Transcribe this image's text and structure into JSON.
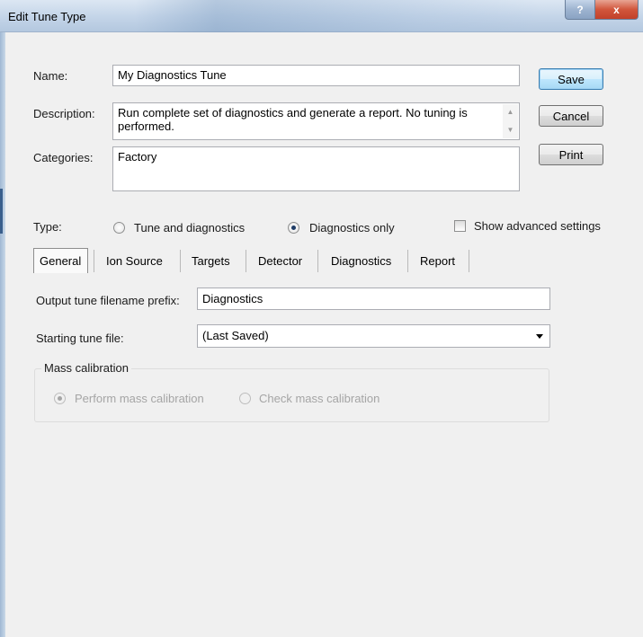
{
  "window": {
    "title": "Edit Tune Type",
    "help_glyph": "?",
    "close_glyph": "x"
  },
  "form": {
    "name_label": "Name:",
    "name_value": "My Diagnostics Tune",
    "description_label": "Description:",
    "description_value": "Run complete set of diagnostics and generate a report. No tuning is performed.",
    "categories_label": "Categories:",
    "categories_value": "Factory"
  },
  "buttons": {
    "save": "Save",
    "cancel": "Cancel",
    "print": "Print"
  },
  "type": {
    "label": "Type:",
    "options": [
      "Tune and diagnostics",
      "Diagnostics only"
    ],
    "selected": "Diagnostics only",
    "advanced_label": "Show advanced settings",
    "advanced_checked": false
  },
  "tabs": [
    "General",
    "Ion Source",
    "Targets",
    "Detector",
    "Diagnostics",
    "Report"
  ],
  "active_tab": "General",
  "general": {
    "output_prefix_label": "Output tune filename prefix:",
    "output_prefix_value": "Diagnostics",
    "starting_tune_label": "Starting tune file:",
    "starting_tune_value": "(Last Saved)",
    "mass_calibration": {
      "title": "Mass calibration",
      "options": [
        "Perform mass calibration",
        "Check mass calibration"
      ],
      "selected": "Perform mass calibration",
      "enabled": false
    }
  },
  "icons": {
    "description_scroll_up": "▲",
    "description_scroll_down": "▼"
  }
}
